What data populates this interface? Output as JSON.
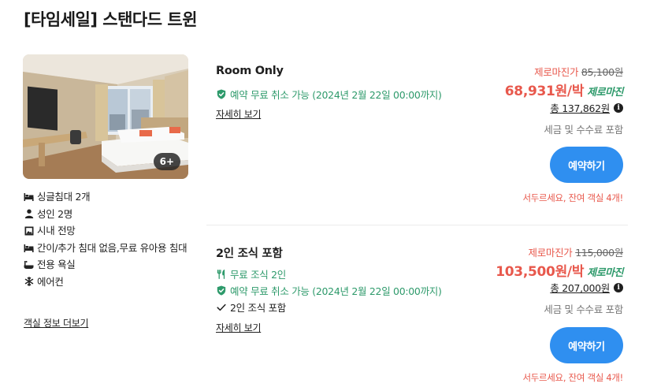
{
  "room": {
    "title": "[타임세일] 스탠다드 트윈",
    "photo_badge": "6+",
    "amenities": [
      {
        "icon": "bed-icon",
        "label": "싱글침대 2개"
      },
      {
        "icon": "person-icon",
        "label": "성인 2명"
      },
      {
        "icon": "window-view-icon",
        "label": "시내 전망"
      },
      {
        "icon": "bed-icon",
        "label": "간이/추가 침대 없음,무료 유아용 침대"
      },
      {
        "icon": "bathtub-icon",
        "label": "전용 욕실"
      },
      {
        "icon": "snowflake-icon",
        "label": "에어컨"
      }
    ],
    "more_link": "객실 정보 더보기"
  },
  "offers": [
    {
      "name": "Room Only",
      "features": [
        {
          "icon": "shield-check-icon",
          "text": "예약 무료 취소 가능 (2024년 2월 22일 00:00까지)",
          "color": "green"
        }
      ],
      "detail_link": "자세히 보기",
      "original_label": "제로마진가",
      "original_price": "85,100원",
      "price": "68,931원/박",
      "price_tag": "제로마진",
      "total": "총 137,862원",
      "tax_note": "세금 및 수수료 포함",
      "book_label": "예약하기",
      "hurry": "서두르세요, 잔여 객실 4개!"
    },
    {
      "name": "2인 조식 포함",
      "features": [
        {
          "icon": "fork-knife-icon",
          "text": "무료 조식 2인",
          "color": "green"
        },
        {
          "icon": "shield-check-icon",
          "text": "예약 무료 취소 가능 (2024년 2월 22일 00:00까지)",
          "color": "green"
        },
        {
          "icon": "checkmark-icon",
          "text": "2인 조식 포함",
          "color": "dark"
        }
      ],
      "detail_link": "자세히 보기",
      "original_label": "제로마진가",
      "original_price": "115,000원",
      "price": "103,500원/박",
      "price_tag": "제로마진",
      "total": "총 207,000원",
      "tax_note": "세금 및 수수료 포함",
      "book_label": "예약하기",
      "hurry": "서두르세요, 잔여 객실 4개!"
    }
  ],
  "colors": {
    "accent_red": "#e8584c",
    "accent_green": "#2e9a6b",
    "button_blue": "#2f8ff0"
  }
}
